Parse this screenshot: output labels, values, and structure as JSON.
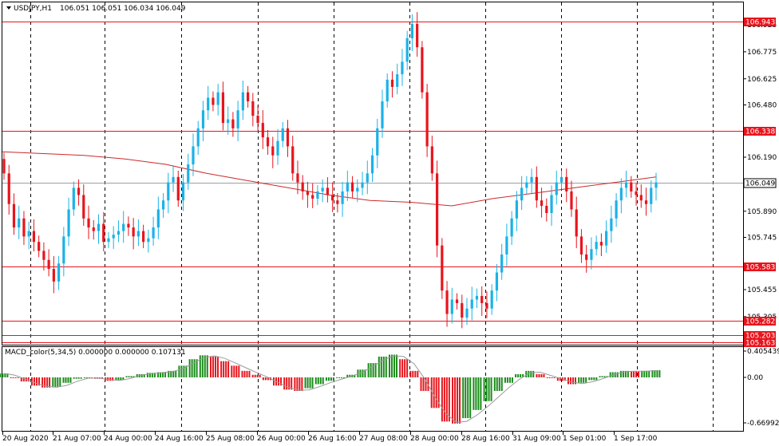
{
  "header": {
    "symbol": "USDJPY,H1",
    "ohlc": "106.051 106.051 106.034 106.049"
  },
  "indicator": {
    "label": "MACD_color(5,34,5) 0.000000 0.000000 0.107131"
  },
  "price_axis": {
    "ticks": [
      "106.925",
      "106.775",
      "106.625",
      "106.480",
      "106.190",
      "105.890",
      "105.745",
      "105.455",
      "105.305"
    ],
    "tick_values": [
      106.925,
      106.775,
      106.625,
      106.48,
      106.19,
      105.89,
      105.745,
      105.455,
      105.305
    ],
    "current_price": "106.049",
    "current_value": 106.049
  },
  "macd_axis": {
    "ticks": [
      "0.405439",
      "0.00",
      "-0.669921"
    ],
    "tick_values": [
      0.405439,
      0,
      -0.669921
    ]
  },
  "levels": [
    {
      "label": "106.943",
      "value": 106.943
    },
    {
      "label": "106.338",
      "value": 106.338
    },
    {
      "label": "105.583",
      "value": 105.583
    },
    {
      "label": "105.282",
      "value": 105.282
    },
    {
      "label": "105.203",
      "value": 105.203
    },
    {
      "label": "105.163",
      "value": 105.163
    }
  ],
  "time_axis": {
    "labels": [
      "20 Aug 2020",
      "21 Aug 07:00",
      "24 Aug 00:00",
      "24 Aug 16:00",
      "25 Aug 08:00",
      "26 Aug 00:00",
      "26 Aug 16:00",
      "27 Aug 08:00",
      "28 Aug 00:00",
      "28 Aug 16:00",
      "31 Aug 09:00",
      "1 Sep 01:00",
      "1 Sep 17:00"
    ]
  },
  "colors": {
    "bull": "#1ab2e8",
    "bear": "#e8141c",
    "level_line": "#e8141c",
    "ma_line": "#cc2a2a",
    "macd_pos": "#1a8c1a",
    "macd_neg": "#e8141c",
    "signal_line": "#9a9a9a",
    "grid": "#000000"
  },
  "chart_data": {
    "type": "candlestick",
    "symbol": "USDJPY",
    "timeframe": "H1",
    "closes": [
      106.1,
      105.93,
      105.8,
      105.85,
      105.75,
      105.78,
      105.72,
      105.67,
      105.62,
      105.57,
      105.5,
      105.6,
      105.75,
      105.9,
      106.02,
      105.98,
      105.85,
      105.8,
      105.78,
      105.82,
      105.72,
      105.74,
      105.76,
      105.78,
      105.82,
      105.8,
      105.75,
      105.78,
      105.72,
      105.74,
      105.8,
      105.9,
      105.95,
      106.05,
      106.08,
      105.95,
      106.05,
      106.15,
      106.25,
      106.35,
      106.45,
      106.52,
      106.48,
      106.55,
      106.38,
      106.4,
      106.35,
      106.45,
      106.55,
      106.5,
      106.42,
      106.38,
      106.3,
      106.25,
      106.2,
      106.28,
      106.35,
      106.25,
      106.1,
      106.05,
      106.0,
      105.98,
      105.96,
      106.0,
      106.02,
      105.98,
      105.95,
      105.93,
      106.0,
      106.05,
      106.0,
      106.02,
      106.05,
      106.1,
      106.2,
      106.35,
      106.5,
      106.62,
      106.58,
      106.65,
      106.72,
      106.85,
      106.93,
      106.8,
      106.55,
      106.25,
      106.1,
      105.7,
      105.45,
      105.32,
      105.4,
      105.38,
      105.3,
      105.35,
      105.4,
      105.42,
      105.38,
      105.35,
      105.45,
      105.55,
      105.65,
      105.75,
      105.85,
      105.95,
      106.02,
      106.05,
      106.08,
      105.95,
      105.92,
      105.88,
      105.98,
      106.05,
      106.08,
      106.0,
      105.9,
      105.75,
      105.65,
      105.62,
      105.68,
      105.72,
      105.7,
      105.78,
      105.85,
      105.95,
      106.02,
      106.05,
      106.0,
      105.98,
      105.95,
      105.93,
      106.02,
      106.05
    ],
    "ma": [
      106.22,
      106.21,
      106.2,
      106.18,
      106.15,
      106.1,
      106.06,
      106.02,
      105.98,
      105.95,
      105.94,
      105.92,
      105.96,
      105.99,
      106.02,
      106.05,
      106.08
    ],
    "macd": [
      0.06,
      0.0,
      -0.06,
      -0.12,
      -0.15,
      -0.14,
      -0.08,
      -0.02,
      0.0,
      -0.02,
      -0.05,
      -0.04,
      0.02,
      0.05,
      0.07,
      0.08,
      0.1,
      0.18,
      0.28,
      0.34,
      0.32,
      0.25,
      0.18,
      0.1,
      0.04,
      -0.04,
      -0.12,
      -0.18,
      -0.2,
      -0.16,
      -0.1,
      -0.05,
      0.0,
      0.04,
      0.12,
      0.22,
      0.32,
      0.35,
      0.28,
      0.1,
      -0.2,
      -0.45,
      -0.65,
      -0.68,
      -0.6,
      -0.48,
      -0.35,
      -0.2,
      -0.08,
      0.05,
      0.1,
      0.05,
      0.0,
      -0.05,
      -0.1,
      -0.08,
      -0.04,
      0.02,
      0.08,
      0.1,
      0.09,
      0.1,
      0.11
    ]
  }
}
